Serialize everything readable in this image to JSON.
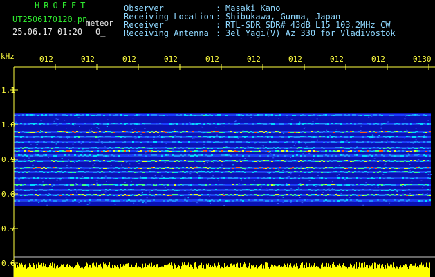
{
  "header": {
    "app_title": "HROFFT",
    "file_name": "UT2506170120.pn",
    "mode": "meteor",
    "datetime": "25.06.17 01:20",
    "counter": "0_",
    "info": [
      {
        "key": "Observer",
        "value": "Masaki Kano"
      },
      {
        "key": "Receiving Location",
        "value": "Shibukawa, Gunma, Japan"
      },
      {
        "key": "Receiver",
        "value": "RTL-SDR SDR# 43dB L15 103.2MHz CW"
      },
      {
        "key": "Receiving Antenna",
        "value": "3el Yagi(V) Az 330 for Vladivostok"
      }
    ]
  },
  "axis": {
    "y_unit": "kHz",
    "y_ticks": [
      "1.1",
      "1.0",
      "0.9",
      "0.8",
      "0.7",
      "0.6"
    ],
    "x_ticks": [
      "012",
      "012",
      "012",
      "012",
      "012",
      "012",
      "012",
      "012",
      "012",
      "0130"
    ]
  },
  "colors": {
    "header_title": "#2ee82e",
    "header_text": "#8fd8ff",
    "axis": "#ffff40",
    "background": "#000000",
    "band_background": "#0a12b4",
    "noise_trace": "#ffff00"
  }
}
